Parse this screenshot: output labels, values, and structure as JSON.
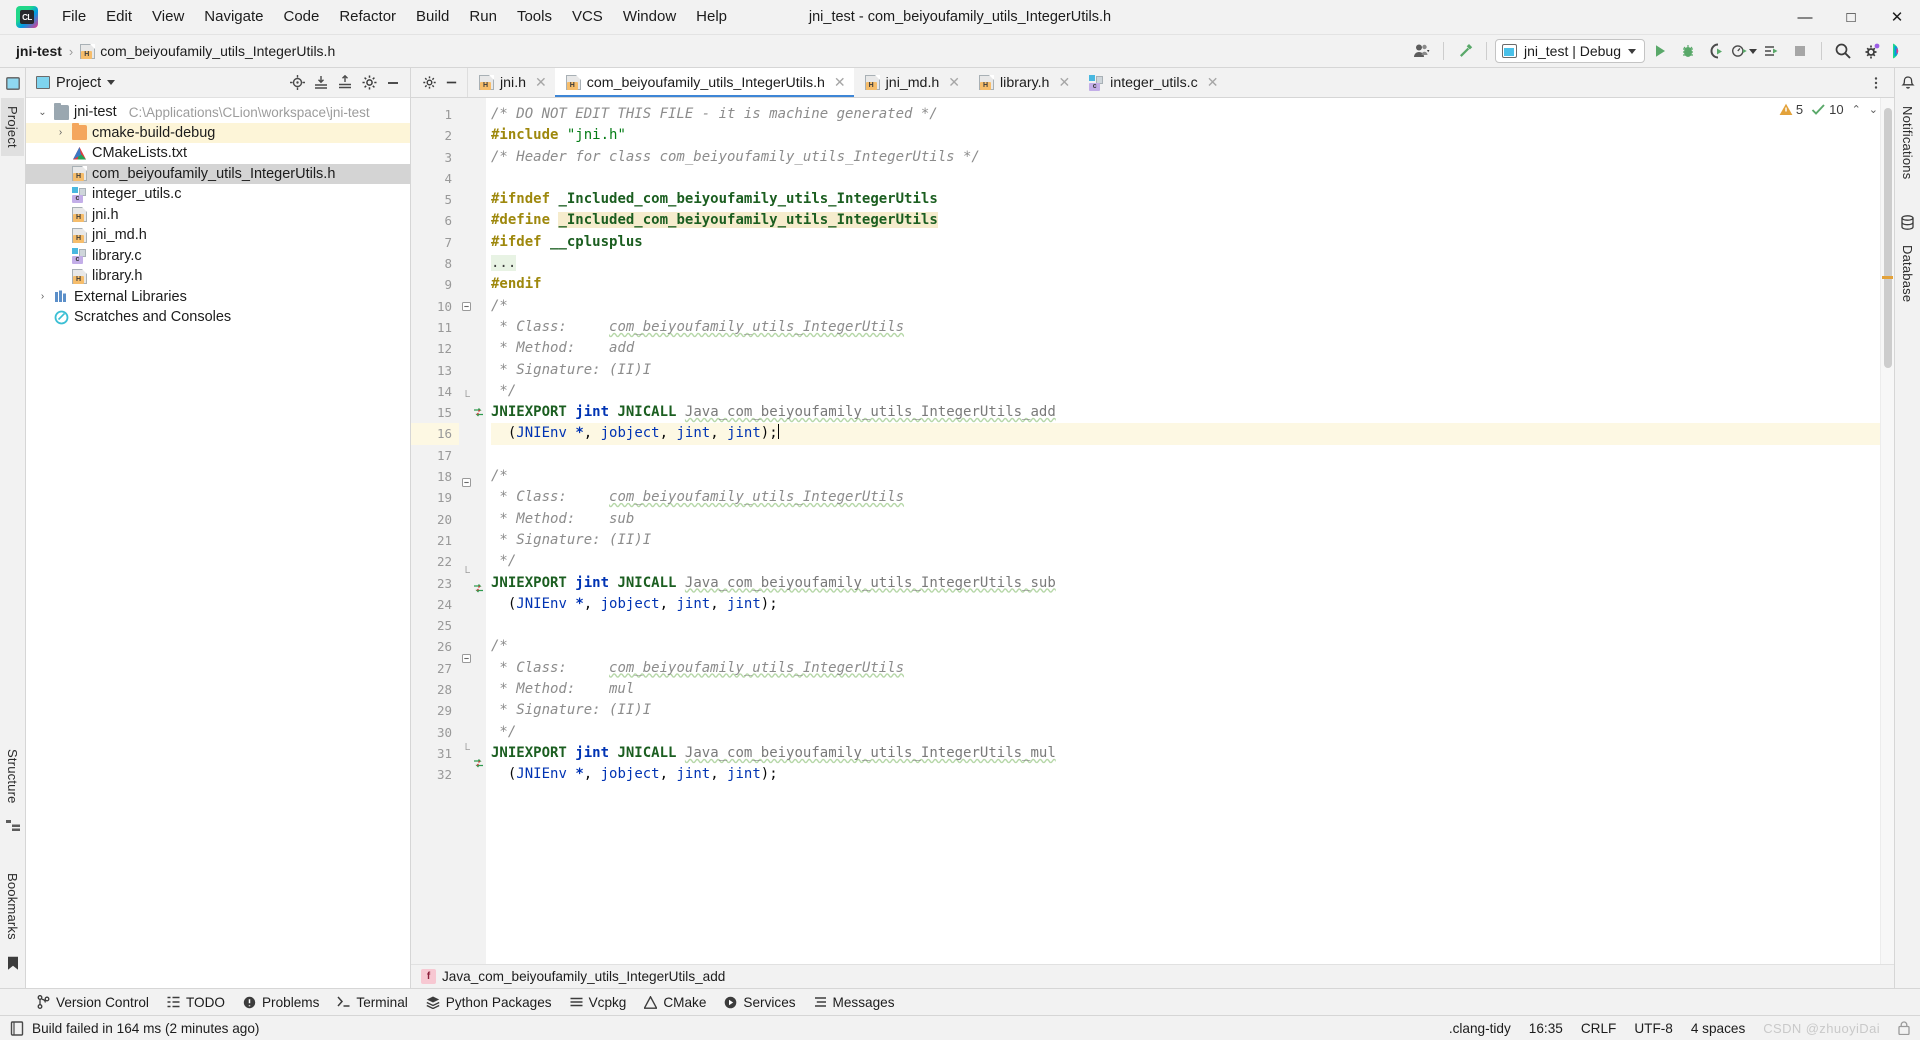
{
  "window": {
    "title": "jni_test - com_beiyoufamily_utils_IntegerUtils.h",
    "minimize": "—",
    "maximize": "□",
    "close": "✕"
  },
  "menu": {
    "items": [
      {
        "label": "File"
      },
      {
        "label": "Edit"
      },
      {
        "label": "View"
      },
      {
        "label": "Navigate"
      },
      {
        "label": "Code"
      },
      {
        "label": "Refactor"
      },
      {
        "label": "Build"
      },
      {
        "label": "Run"
      },
      {
        "label": "Tools"
      },
      {
        "label": "VCS"
      },
      {
        "label": "Window"
      },
      {
        "label": "Help"
      }
    ]
  },
  "navbar": {
    "breadcrumbs": [
      {
        "label": "jni-test",
        "icon": "project-icon"
      },
      {
        "label": "com_beiyoufamily_utils_IntegerUtils.h",
        "icon": "header-file-icon"
      }
    ],
    "separator": "›",
    "run_config": {
      "label": "jni_test | Debug",
      "icon": "run-config-icon"
    },
    "actions": [
      {
        "name": "user-account-icon",
        "label": ""
      },
      {
        "name": "build-hammer-icon",
        "label": ""
      },
      {
        "name": "run-icon",
        "label": ""
      },
      {
        "name": "debug-icon",
        "label": ""
      },
      {
        "name": "run-with-coverage-icon",
        "label": ""
      },
      {
        "name": "profiler-icon",
        "label": ""
      },
      {
        "name": "attach-to-process-icon",
        "label": ""
      },
      {
        "name": "stop-icon",
        "label": ""
      },
      {
        "name": "search-everywhere-icon",
        "label": ""
      },
      {
        "name": "settings-gear-icon",
        "label": ""
      },
      {
        "name": "ai-assistant-icon",
        "label": ""
      }
    ]
  },
  "left_stripe": {
    "tabs": [
      {
        "label": "Project",
        "selected": true
      },
      {
        "label": "Structure",
        "selected": false
      },
      {
        "label": "Bookmarks",
        "selected": false
      }
    ]
  },
  "right_stripe": {
    "tabs": [
      {
        "label": "Notifications"
      },
      {
        "label": "Database"
      }
    ]
  },
  "project_panel": {
    "title": "Project",
    "dropdown_caret": "▾",
    "actions": [
      "locate-icon",
      "expand-all-icon",
      "collapse-all-icon",
      "settings-icon",
      "hide-icon"
    ],
    "tree": [
      {
        "label": "jni-test",
        "path": "C:\\Applications\\CLion\\workspace\\jni-test",
        "arrow": "⌄",
        "indent": 0,
        "icon": "folder-gray",
        "state": "normal"
      },
      {
        "label": "cmake-build-debug",
        "path": "",
        "arrow": "›",
        "indent": 1,
        "icon": "folder-orange",
        "state": "highlighted"
      },
      {
        "label": "CMakeLists.txt",
        "path": "",
        "arrow": "",
        "indent": 1,
        "icon": "cmake",
        "state": "normal"
      },
      {
        "label": "com_beiyoufamily_utils_IntegerUtils.h",
        "path": "",
        "arrow": "",
        "indent": 1,
        "icon": "header",
        "state": "selected"
      },
      {
        "label": "integer_utils.c",
        "path": "",
        "arrow": "",
        "indent": 1,
        "icon": "csource",
        "state": "normal"
      },
      {
        "label": "jni.h",
        "path": "",
        "arrow": "",
        "indent": 1,
        "icon": "header",
        "state": "normal"
      },
      {
        "label": "jni_md.h",
        "path": "",
        "arrow": "",
        "indent": 1,
        "icon": "header",
        "state": "normal"
      },
      {
        "label": "library.c",
        "path": "",
        "arrow": "",
        "indent": 1,
        "icon": "csource",
        "state": "normal"
      },
      {
        "label": "library.h",
        "path": "",
        "arrow": "",
        "indent": 1,
        "icon": "header",
        "state": "normal"
      },
      {
        "label": "External Libraries",
        "path": "",
        "arrow": "›",
        "indent": 0,
        "icon": "libraries",
        "state": "normal"
      },
      {
        "label": "Scratches and Consoles",
        "path": "",
        "arrow": "",
        "indent": 0,
        "icon": "scratch",
        "state": "normal"
      }
    ]
  },
  "editor": {
    "tabs": [
      {
        "label": "jni.h",
        "icon": "header-file-icon",
        "active": false,
        "close": "✕"
      },
      {
        "label": "com_beiyoufamily_utils_IntegerUtils.h",
        "icon": "header-file-icon",
        "active": true,
        "close": "✕"
      },
      {
        "label": "jni_md.h",
        "icon": "header-file-icon",
        "active": false,
        "close": "✕"
      },
      {
        "label": "library.h",
        "icon": "header-file-icon",
        "active": false,
        "close": "✕"
      },
      {
        "label": "integer_utils.c",
        "icon": "c-file-icon",
        "active": false,
        "close": "✕"
      }
    ],
    "inspection": {
      "warnings": "5",
      "checks": "10",
      "warning_icon": "warning-triangle-icon",
      "check_icon": "check-icon",
      "caret_up": "⌃",
      "caret_down": "⌄"
    },
    "breadcrumb": {
      "label": "Java_com_beiyoufamily_utils_IntegerUtils_add",
      "badge": "f"
    },
    "lines": [
      {
        "n": 1,
        "fold": "",
        "marker": "",
        "hl": false
      },
      {
        "n": 2,
        "fold": "",
        "marker": "",
        "hl": false
      },
      {
        "n": 3,
        "fold": "",
        "marker": "",
        "hl": false
      },
      {
        "n": 4,
        "fold": "",
        "marker": "",
        "hl": false
      },
      {
        "n": 5,
        "fold": "",
        "marker": "",
        "hl": false
      },
      {
        "n": 6,
        "fold": "",
        "marker": "",
        "hl": false
      },
      {
        "n": 7,
        "fold": "",
        "marker": "",
        "hl": false
      },
      {
        "n": 8,
        "fold": "",
        "marker": "",
        "hl": false
      },
      {
        "n": 9,
        "fold": "",
        "marker": "",
        "hl": false
      },
      {
        "n": 10,
        "fold": "fold-start",
        "marker": "",
        "hl": false
      },
      {
        "n": 11,
        "fold": "",
        "marker": "",
        "hl": false
      },
      {
        "n": 12,
        "fold": "",
        "marker": "",
        "hl": false
      },
      {
        "n": 13,
        "fold": "",
        "marker": "",
        "hl": false
      },
      {
        "n": 14,
        "fold": "fold-end",
        "marker": "",
        "hl": false
      },
      {
        "n": 15,
        "fold": "",
        "marker": "gutter-impl-icon",
        "hl": false
      },
      {
        "n": 16,
        "fold": "",
        "marker": "",
        "hl": true
      },
      {
        "n": 17,
        "fold": "",
        "marker": "",
        "hl": false
      },
      {
        "n": 18,
        "fold": "fold-start",
        "marker": "",
        "hl": false
      },
      {
        "n": 19,
        "fold": "",
        "marker": "",
        "hl": false
      },
      {
        "n": 20,
        "fold": "",
        "marker": "",
        "hl": false
      },
      {
        "n": 21,
        "fold": "",
        "marker": "",
        "hl": false
      },
      {
        "n": 22,
        "fold": "fold-end",
        "marker": "",
        "hl": false
      },
      {
        "n": 23,
        "fold": "",
        "marker": "gutter-impl-icon",
        "hl": false
      },
      {
        "n": 24,
        "fold": "",
        "marker": "",
        "hl": false
      },
      {
        "n": 25,
        "fold": "",
        "marker": "",
        "hl": false
      },
      {
        "n": 26,
        "fold": "fold-start",
        "marker": "",
        "hl": false
      },
      {
        "n": 27,
        "fold": "",
        "marker": "",
        "hl": false
      },
      {
        "n": 28,
        "fold": "",
        "marker": "",
        "hl": false
      },
      {
        "n": 29,
        "fold": "",
        "marker": "",
        "hl": false
      },
      {
        "n": 30,
        "fold": "fold-end",
        "marker": "",
        "hl": false
      },
      {
        "n": 31,
        "fold": "",
        "marker": "gutter-impl-icon",
        "hl": false
      },
      {
        "n": 32,
        "fold": "",
        "marker": "",
        "hl": false
      }
    ],
    "code_text": [
      "/* DO NOT EDIT THIS FILE - it is machine generated */",
      "#include \"jni.h\"",
      "/* Header for class com_beiyoufamily_utils_IntegerUtils */",
      "",
      "#ifndef _Included_com_beiyoufamily_utils_IntegerUtils",
      "#define _Included_com_beiyoufamily_utils_IntegerUtils",
      "#ifdef __cplusplus",
      "...",
      "#endif",
      "/*",
      " * Class:     com_beiyoufamily_utils_IntegerUtils",
      " * Method:    add",
      " * Signature: (II)I",
      " */",
      "JNIEXPORT jint JNICALL Java_com_beiyoufamily_utils_IntegerUtils_add",
      "  (JNIEnv *, jobject, jint, jint);",
      "",
      "/*",
      " * Class:     com_beiyoufamily_utils_IntegerUtils",
      " * Method:    sub",
      " * Signature: (II)I",
      " */",
      "JNIEXPORT jint JNICALL Java_com_beiyoufamily_utils_IntegerUtils_sub",
      "  (JNIEnv *, jobject, jint, jint);",
      "",
      "/*",
      " * Class:     com_beiyoufamily_utils_IntegerUtils",
      " * Method:    mul",
      " * Signature: (II)I",
      " */",
      "JNIEXPORT jint JNICALL Java_com_beiyoufamily_utils_IntegerUtils_mul",
      "  (JNIEnv *, jobject, jint, jint);"
    ]
  },
  "tool_windows": [
    {
      "label": "Version Control",
      "icon": "branch-icon"
    },
    {
      "label": "TODO",
      "icon": "list-icon"
    },
    {
      "label": "Problems",
      "icon": "exclamation-icon"
    },
    {
      "label": "Terminal",
      "icon": "terminal-icon"
    },
    {
      "label": "Python Packages",
      "icon": "packages-icon"
    },
    {
      "label": "Vcpkg",
      "icon": "vcpkg-icon"
    },
    {
      "label": "CMake",
      "icon": "cmake-icon"
    },
    {
      "label": "Services",
      "icon": "services-icon"
    },
    {
      "label": "Messages",
      "icon": "messages-icon"
    }
  ],
  "statusbar": {
    "build_status": "Build failed in 164 ms (2 minutes ago)",
    "build_icon": "build-icon",
    "right_items": [
      {
        "label": ".clang-tidy"
      },
      {
        "label": "16:35"
      },
      {
        "label": "CRLF"
      },
      {
        "label": "UTF-8"
      },
      {
        "label": "4 spaces"
      }
    ],
    "watermark": "CSDN @zhuoyiDai",
    "lock_icon": "lock-icon"
  },
  "colors": {
    "accent_blue": "#3e86d6",
    "run_green": "#59a869",
    "warning_orange": "#e3a23a",
    "keyword_blue": "#0033b3",
    "preproc_yellow": "#9e880d",
    "string_green": "#067d17",
    "comment_gray": "#8c8c8c",
    "selection_gray": "#d4d4d4",
    "highlight_yellow": "#fdf8e3",
    "panel_bg": "#f2f2f2"
  }
}
